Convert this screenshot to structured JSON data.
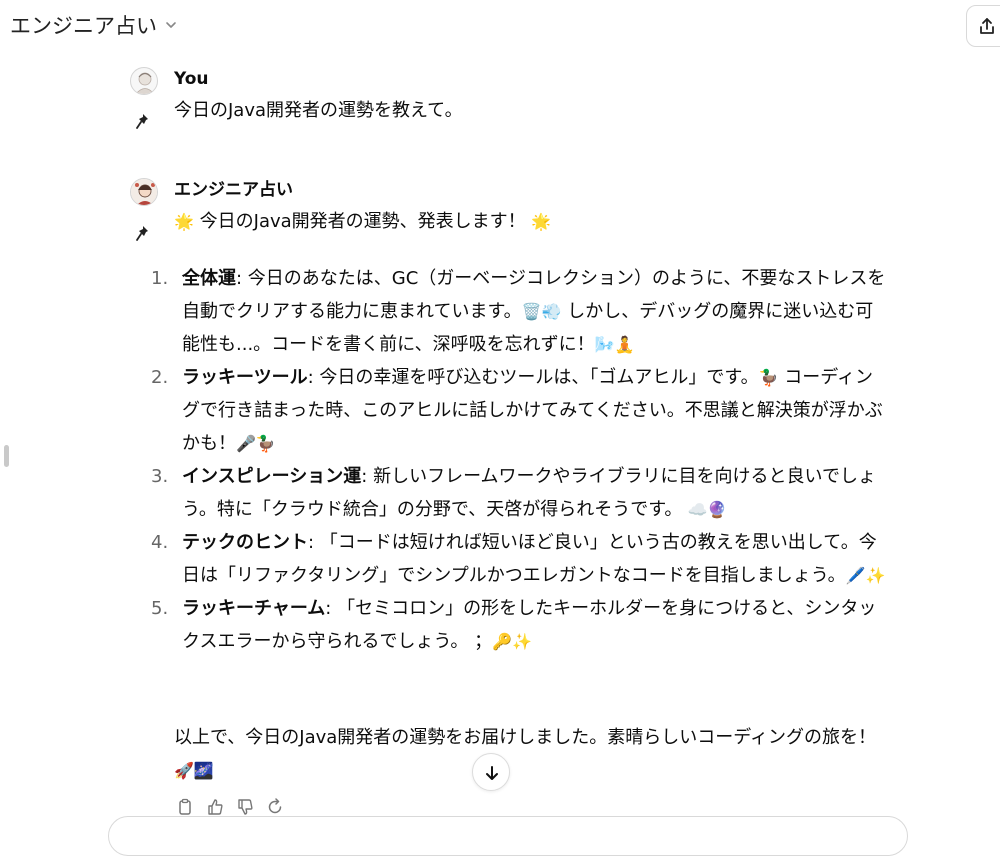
{
  "header": {
    "title": "エンジニア占い"
  },
  "user_message": {
    "author": "You",
    "text": "今日のJava開発者の運勢を教えて。"
  },
  "assistant_message": {
    "author": "エンジニア占い",
    "intro_emoji_left": "🌟",
    "intro_text": " 今日のJava開発者の運勢、発表します！ ",
    "intro_emoji_right": "🌟",
    "items": [
      {
        "number": "1.",
        "title": "全体運",
        "body": ": 今日のあなたは、GC（ガーベージコレクション）のように、不要なストレスを自動でクリアする能力に恵まれています。",
        "emoji1": "🗑️💨",
        "body2": " しかし、デバッグの魔界に迷い込む可能性も...。コードを書く前に、深呼吸を忘れずに！",
        "emoji2": "🌬️🧘"
      },
      {
        "number": "2.",
        "title": "ラッキーツール",
        "body": ": 今日の幸運を呼び込むツールは、「ゴムアヒル」です。",
        "emoji1": "🦆",
        "body2": " コーディングで行き詰まった時、このアヒルに話しかけてみてください。不思議と解決策が浮かぶかも！",
        "emoji2": "🎤🦆"
      },
      {
        "number": "3.",
        "title": "インスピレーション運",
        "body": ": 新しいフレームワークやライブラリに目を向けると良いでしょう。特に「クラウド統合」の分野で、天啓が得られそうです。",
        "emoji1": " ☁️🔮",
        "body2": "",
        "emoji2": ""
      },
      {
        "number": "4.",
        "title": "テックのヒント",
        "body": ": 「コードは短ければ短いほど良い」という古の教えを思い出して。今日は「リファクタリング」でシンプルかつエレガントなコードを目指しましょう。",
        "emoji1": "🖊️✨",
        "body2": "",
        "emoji2": ""
      },
      {
        "number": "5.",
        "title": "ラッキーチャーム",
        "body": ": 「セミコロン」の形をしたキーホルダーを身につけると、シンタックスエラーから守られるでしょう。 ；",
        "emoji1": "🔑✨",
        "body2": "",
        "emoji2": ""
      }
    ],
    "closing_text": "以上で、今日のJava開発者の運勢をお届けしました。素晴らしいコーディングの旅を！",
    "closing_emoji": "🚀🌌"
  },
  "actions": {
    "icons": [
      "copy-icon",
      "thumbs-up-icon",
      "thumbs-down-icon",
      "regenerate-icon"
    ]
  }
}
